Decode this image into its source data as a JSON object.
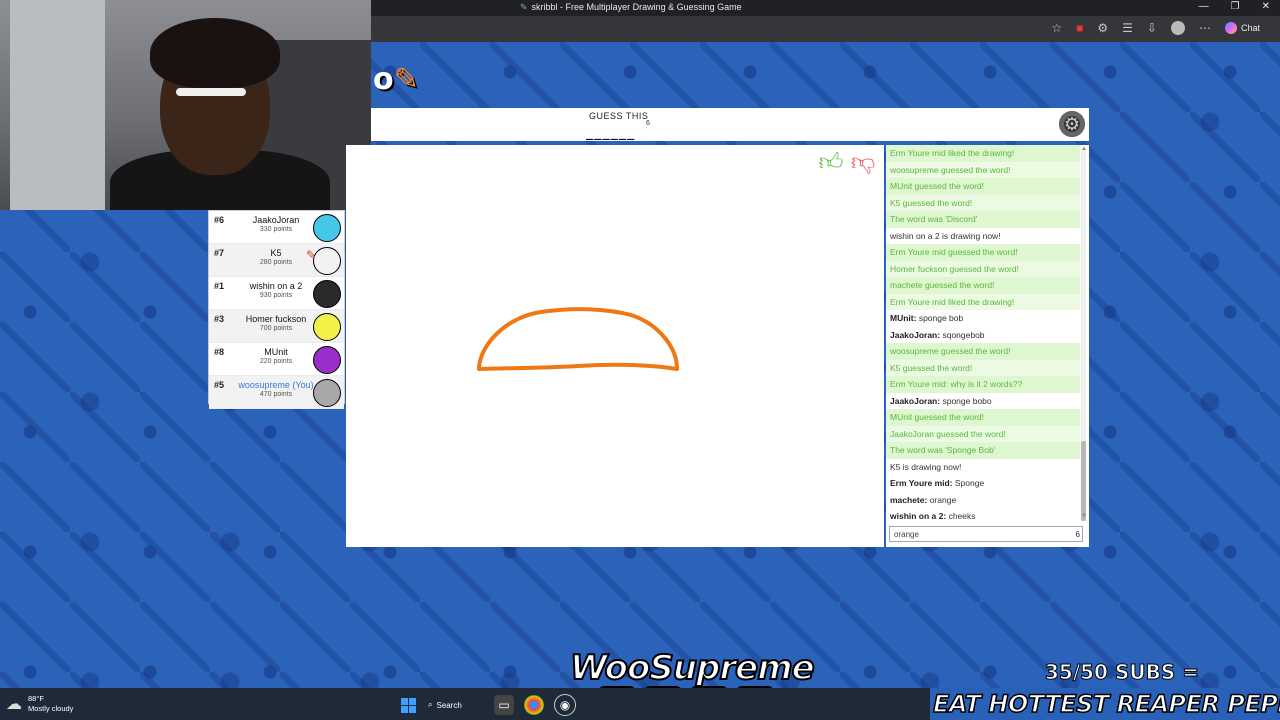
{
  "browser": {
    "title": "skribbl - Free Multiplayer Drawing & Guessing Game",
    "chat_label": "Chat"
  },
  "game": {
    "guess_label": "GUESS THIS",
    "letter_count": "6",
    "blanks": "______",
    "canvas": {
      "stroke_color": "#f07814",
      "background": "#ffffff"
    }
  },
  "players": [
    {
      "rank": "#6",
      "name": "JaakoJoran",
      "points": "330 points",
      "avatar_color": "#45c7e8",
      "you": false
    },
    {
      "rank": "#7",
      "name": "K5",
      "points": "280 points",
      "avatar_color": "#f2f2f2",
      "you": false
    },
    {
      "rank": "#1",
      "name": "wishin on a 2",
      "points": "930 points",
      "avatar_color": "#2a2a2a",
      "you": false
    },
    {
      "rank": "#3",
      "name": "Homer fuckson",
      "points": "700 points",
      "avatar_color": "#f3f04a",
      "you": false
    },
    {
      "rank": "#8",
      "name": "MUnit",
      "points": "220 points",
      "avatar_color": "#9a2ec8",
      "you": false
    },
    {
      "rank": "#5",
      "name": "woosupreme (You)",
      "points": "470 points",
      "avatar_color": "#a8a8a8",
      "you": true
    }
  ],
  "chat": {
    "messages": [
      {
        "type": "green",
        "text": "Erm Youre mid liked the drawing!"
      },
      {
        "type": "green",
        "text": "woosupreme guessed the word!"
      },
      {
        "type": "green",
        "text": "MUnit guessed the word!"
      },
      {
        "type": "green",
        "text": "K5 guessed the word!"
      },
      {
        "type": "green",
        "text": "The word was 'Discord'"
      },
      {
        "type": "blue",
        "text": "wishin on a 2 is drawing now!"
      },
      {
        "type": "green",
        "text": "Erm Youre mid guessed the word!"
      },
      {
        "type": "green",
        "text": "Homer fuckson guessed the word!"
      },
      {
        "type": "green",
        "text": "machete guessed the word!"
      },
      {
        "type": "green",
        "text": "Erm Youre mid liked the drawing!"
      },
      {
        "type": "msg",
        "who": "MUnit:",
        "text": "sponge bob"
      },
      {
        "type": "msg",
        "who": "JaakoJoran:",
        "text": "sqongebob"
      },
      {
        "type": "green",
        "text": "woosupreme guessed the word!"
      },
      {
        "type": "green",
        "text": "K5 guessed the word!"
      },
      {
        "type": "green",
        "who": "Erm Youre mid:",
        "text": "why is it 2 words??"
      },
      {
        "type": "msg",
        "who": "JaakoJoran:",
        "text": "sponge bobo"
      },
      {
        "type": "green",
        "text": "MUnit guessed the word!"
      },
      {
        "type": "green",
        "text": "JaakoJoran guessed the word!"
      },
      {
        "type": "green",
        "text": "The word was 'Sponge Bob'"
      },
      {
        "type": "blue",
        "text": "K5 is drawing now!"
      },
      {
        "type": "msg",
        "who": "Erm Youre mid:",
        "text": "Sponge"
      },
      {
        "type": "msg",
        "who": "machete:",
        "text": "orange"
      },
      {
        "type": "msg",
        "who": "wishin on a 2:",
        "text": "cheeks"
      }
    ],
    "input_value": "orange",
    "char_count": "6"
  },
  "overlay": {
    "brand": "WooSupreme",
    "subs": "35/50 SUBS =",
    "challenge": "EAT HOTTEST REAPER PEPPER"
  },
  "taskbar": {
    "temperature": "88°F",
    "weather": "Mostly cloudy",
    "search_label": "Search"
  }
}
